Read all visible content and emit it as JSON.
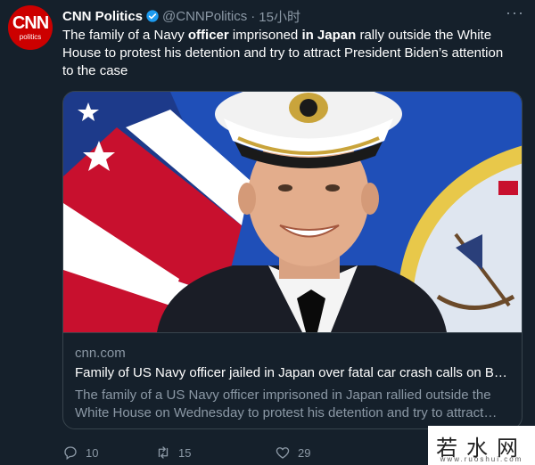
{
  "tweet": {
    "avatar_logo": "CNN",
    "avatar_sub": "politics",
    "display_name": "CNN Politics",
    "handle": "@CNNPolitics",
    "separator": "·",
    "time": "15小时",
    "text_parts": [
      "The family of a Navy ",
      "officer",
      " imprisoned ",
      "in Japan",
      " rally outside the White House to protest his detention and try to attract President Biden’s attention to the case"
    ],
    "more_label": "···"
  },
  "card": {
    "domain": "cnn.com",
    "title": "Family of US Navy officer jailed in Japan over fatal car crash calls on B…",
    "description": "The family of a US Navy officer imprisoned in Japan rallied outside the White House on Wednesday to protest his detention and try to attract…"
  },
  "actions": {
    "reply_count": "10",
    "retweet_count": "15",
    "like_count": "29"
  },
  "watermark": {
    "text": "若水网",
    "sub": "www.ruoshui.com"
  },
  "colors": {
    "background": "#15202b",
    "secondary_text": "#8b98a5",
    "border": "#38444d",
    "verified": "#1d9bf0",
    "brand": "#cc0000"
  }
}
